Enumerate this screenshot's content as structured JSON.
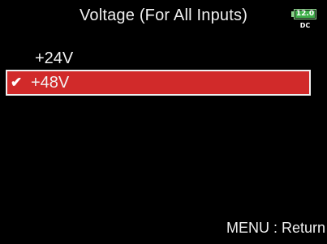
{
  "header": {
    "title": "Voltage (For All Inputs)"
  },
  "battery": {
    "level": "12.0",
    "source": "DC",
    "color": "#3fae4a"
  },
  "menu": {
    "items": [
      {
        "label": "+24V",
        "selected": false
      },
      {
        "label": "+48V",
        "selected": true,
        "check_icon": "checkmark-icon"
      }
    ],
    "highlight_color": "#d12a2a"
  },
  "footer": {
    "hint": "MENU : Return"
  }
}
